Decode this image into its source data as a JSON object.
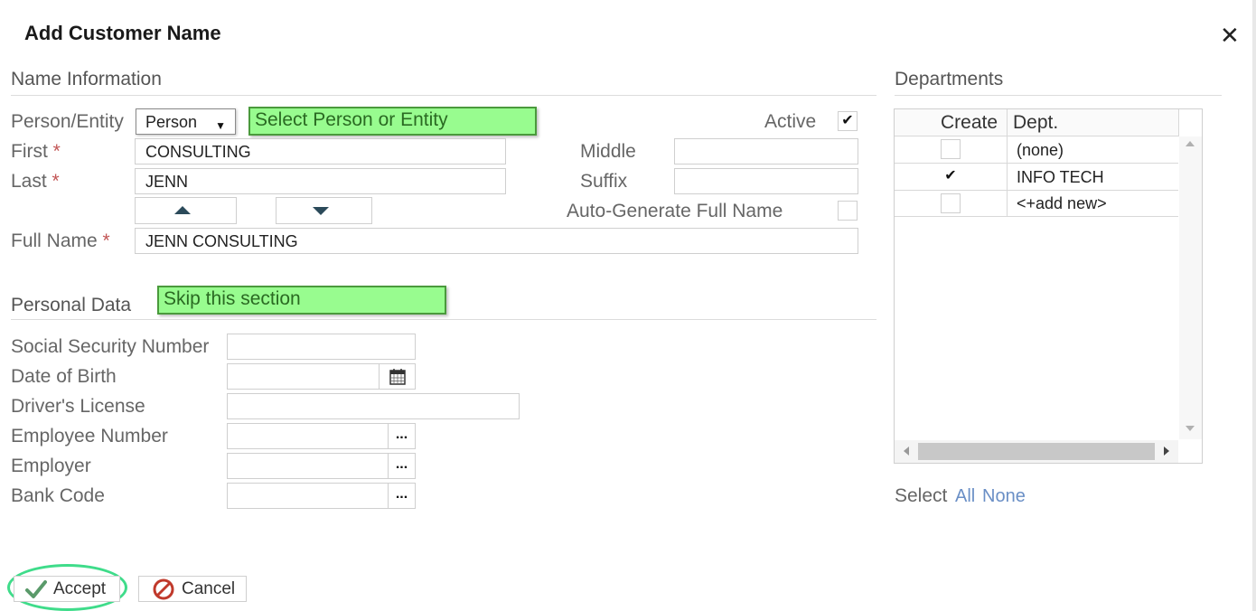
{
  "dialog": {
    "title": "Add Customer Name",
    "close_glyph": "✕"
  },
  "name_info": {
    "heading": "Name Information",
    "person_entity_label": "Person/Entity",
    "person_entity_value": "Person",
    "person_entity_note": "Select Person or Entity",
    "active_label": "Active",
    "active_checked": "✔",
    "first_label": "First",
    "first_value": "CONSULTING",
    "middle_label": "Middle",
    "middle_value": "",
    "last_label": "Last",
    "last_value": "JENN",
    "suffix_label": "Suffix",
    "suffix_value": "",
    "auto_generate_label": "Auto-Generate Full Name",
    "full_name_label": "Full Name",
    "full_name_value": "JENN CONSULTING",
    "required_mark": "*"
  },
  "personal_data": {
    "heading": "Personal Data",
    "note": "Skip this section",
    "fields": {
      "ssn": "Social Security Number",
      "dob": "Date of Birth",
      "license": "Driver's License",
      "employee_number": "Employee Number",
      "employer": "Employer",
      "bank_code": "Bank Code"
    },
    "ellipsis": "..."
  },
  "departments": {
    "heading": "Departments",
    "columns": {
      "create": "Create",
      "dept": "Dept."
    },
    "rows": [
      {
        "checked": "",
        "dept": "(none)"
      },
      {
        "checked": "✔",
        "dept": "INFO TECH"
      },
      {
        "checked": "",
        "dept": "<+add new>"
      }
    ],
    "select_label": "Select",
    "select_all": "All",
    "select_none": "None"
  },
  "footer": {
    "accept_label": "Accept",
    "cancel_label": "Cancel"
  },
  "colors": {
    "note_bg": "#98fc8f",
    "highlight_ring": "#3fdc8a",
    "link": "#6a8fc6",
    "accept_check": "#5a9a6a",
    "cancel_icon": "#c0392b"
  },
  "icons": [
    "close-icon",
    "caret-down-icon",
    "checkmark-icon",
    "arrow-up-icon",
    "arrow-down-icon",
    "calendar-icon",
    "ellipsis-icon",
    "scroll-up-icon",
    "scroll-down-icon",
    "scroll-left-icon",
    "scroll-right-icon",
    "cancel-icon"
  ]
}
